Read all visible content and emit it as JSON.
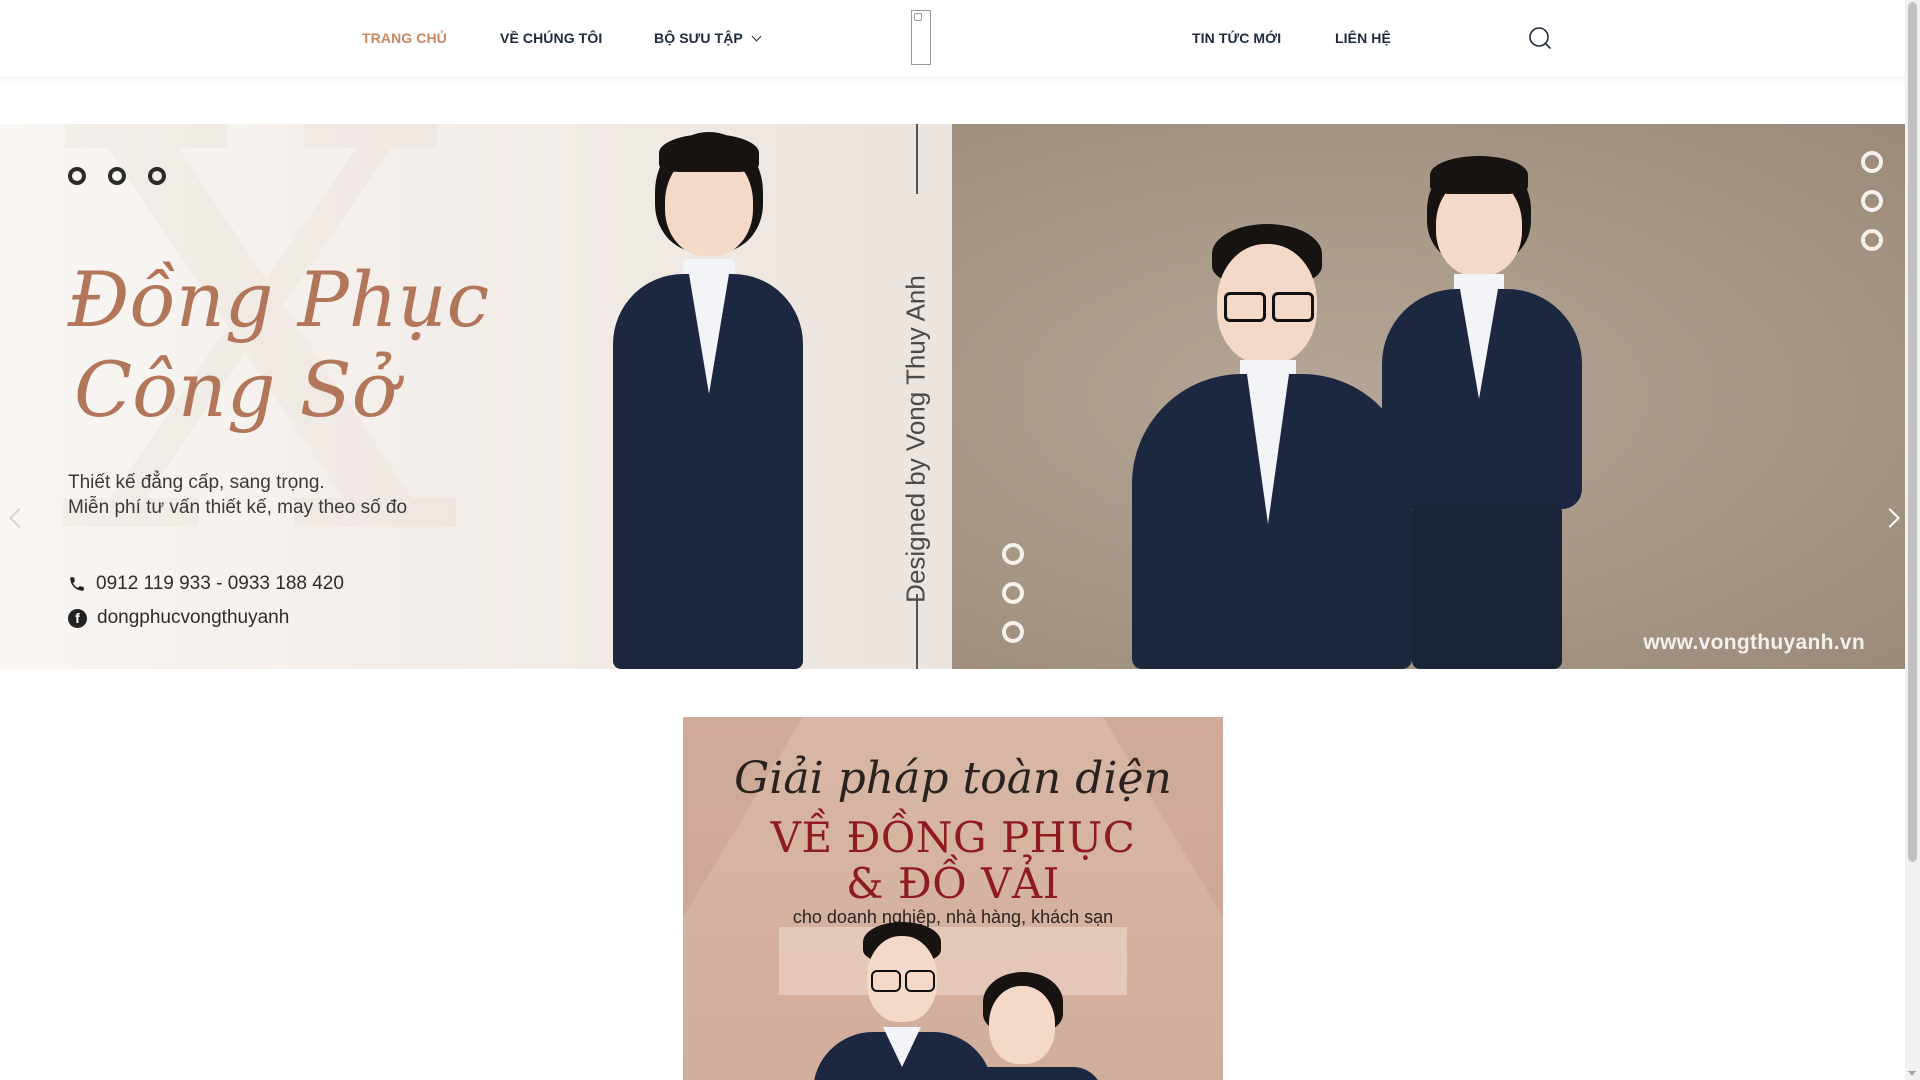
{
  "nav": {
    "items": [
      {
        "label": "TRANG CHỦ",
        "active": true
      },
      {
        "label": "VỀ CHÚNG TÔI"
      },
      {
        "label": "BỘ SƯU TẬP",
        "has_dropdown": true
      },
      {
        "label": "TIN TỨC MỚI"
      },
      {
        "label": "LIÊN HỆ"
      }
    ],
    "search_icon": "search-icon",
    "logo_icon": "broken-image-icon"
  },
  "hero": {
    "title_line1": "Đồng Phục",
    "title_line2": "Công Sở",
    "tagline_line1": "Thiết kế đẳng cấp, sang trọng.",
    "tagline_line2": "Miễn phí tư vấn thiết kế, may theo số đo",
    "phone": "0912 119 933 - 0933 188 420",
    "facebook": "dongphucvongthuyanh",
    "vertical_text": "Designed by Vong Thuy Anh",
    "website": "www.vongthuyanh.vn"
  },
  "banner": {
    "script": "Giải pháp toàn diện",
    "title_line1": "VỀ ĐỒNG PHỤC",
    "title_line2": "& ĐỒ VẢI",
    "subtitle": "cho doanh nghiệp, nhà hàng, khách sạn"
  },
  "colors": {
    "accent": "#c8875f",
    "nav_text": "#1f2a3e",
    "hero_title": "#b2765a",
    "banner_title": "#8e1b1f",
    "banner_bg": "#d5b2a0"
  }
}
